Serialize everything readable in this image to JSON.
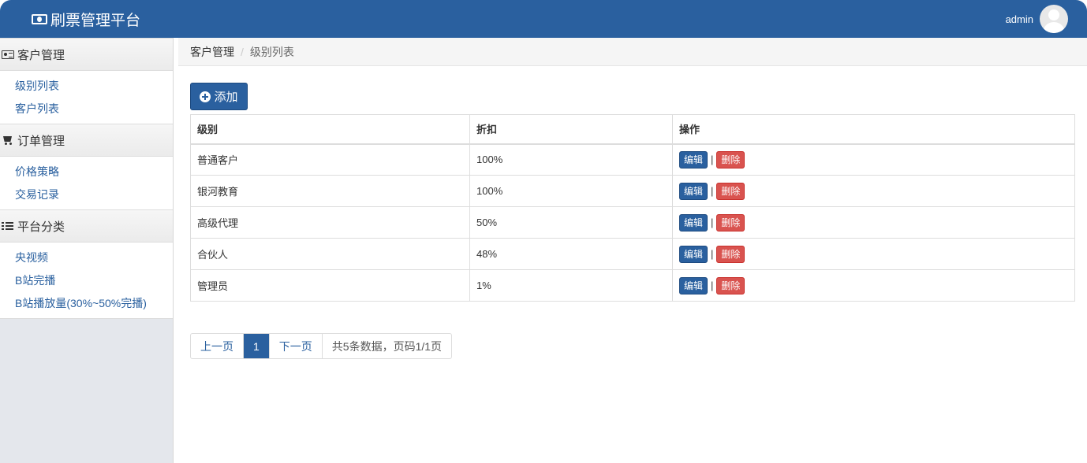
{
  "header": {
    "title": "刷票管理平台",
    "user": "admin"
  },
  "sidebar": {
    "groups": [
      {
        "title": "客户管理",
        "icon": "id-card-icon",
        "items": [
          "级别列表",
          "客户列表"
        ]
      },
      {
        "title": "订单管理",
        "icon": "shopping-cart-icon",
        "items": [
          "价格策略",
          "交易记录"
        ]
      },
      {
        "title": "平台分类",
        "icon": "list-icon",
        "items": [
          "央视频",
          "B站完播",
          "B站播放量(30%~50%完播)"
        ]
      }
    ]
  },
  "breadcrumb": {
    "parent": "客户管理",
    "current": "级别列表"
  },
  "toolbar": {
    "add_label": "添加"
  },
  "table": {
    "headers": [
      "级别",
      "折扣",
      "操作"
    ],
    "rows": [
      {
        "level": "普通客户",
        "discount": "100%"
      },
      {
        "level": "银河教育",
        "discount": "100%"
      },
      {
        "level": "高级代理",
        "discount": "50%"
      },
      {
        "level": "合伙人",
        "discount": "48%"
      },
      {
        "level": "管理员",
        "discount": "1%"
      }
    ],
    "edit_label": "编辑",
    "delete_label": "删除",
    "separator": "|"
  },
  "pagination": {
    "prev": "上一页",
    "current": "1",
    "next": "下一页",
    "summary": "共5条数据，页码1/1页"
  }
}
